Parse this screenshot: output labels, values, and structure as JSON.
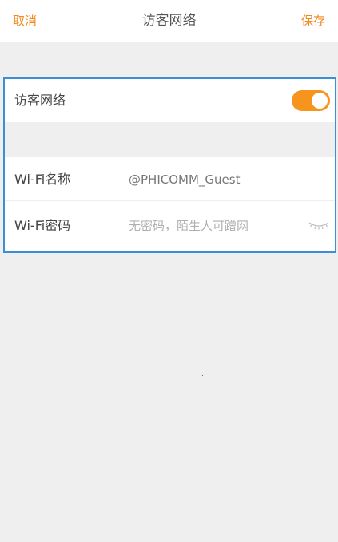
{
  "navbar": {
    "cancel_label": "取消",
    "title": "访客网络",
    "save_label": "保存"
  },
  "guest_network": {
    "label": "访客网络",
    "enabled": true
  },
  "wifi_name": {
    "label": "Wi-Fi名称",
    "value": "@PHICOMM_Guest"
  },
  "wifi_password": {
    "label": "Wi-Fi密码",
    "value": "",
    "placeholder": "无密码，陌生人可蹭网",
    "visibility_icon": "eye-closed-icon"
  },
  "colors": {
    "accent": "#f7941d",
    "nav_text": "#f08a1c",
    "highlight_border": "#3c8fd6",
    "background": "#efefef"
  }
}
